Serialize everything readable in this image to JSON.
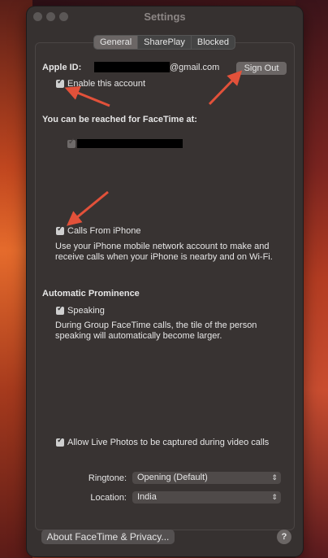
{
  "window": {
    "title": "Settings"
  },
  "tabs": [
    {
      "label": "General",
      "active": true
    },
    {
      "label": "SharePlay",
      "active": false
    },
    {
      "label": "Blocked",
      "active": false
    }
  ],
  "account": {
    "apple_id_label": "Apple ID:",
    "apple_id_value": "@gmail.com",
    "sign_out_label": "Sign Out",
    "enable_label": "Enable this account"
  },
  "reach": {
    "heading": "You can be reached for FaceTime at:"
  },
  "calls": {
    "label": "Calls From iPhone",
    "description_line1": "Use your iPhone mobile network account to make and",
    "description_line2": "receive calls when your iPhone is nearby and on Wi-Fi."
  },
  "prominence": {
    "heading": "Automatic Prominence",
    "speaking_label": "Speaking",
    "description_line1": "During Group FaceTime calls, the tile of the person",
    "description_line2": "speaking will automatically become larger."
  },
  "live_photos": {
    "label": "Allow Live Photos to be captured during video calls"
  },
  "ringtone": {
    "label": "Ringtone:",
    "value": "Opening (Default)"
  },
  "location": {
    "label": "Location:",
    "value": "India"
  },
  "footer": {
    "about_label": "About FaceTime & Privacy...",
    "help_label": "?"
  },
  "colors": {
    "arrow": "#e2513a",
    "window_bg": "#363130"
  }
}
